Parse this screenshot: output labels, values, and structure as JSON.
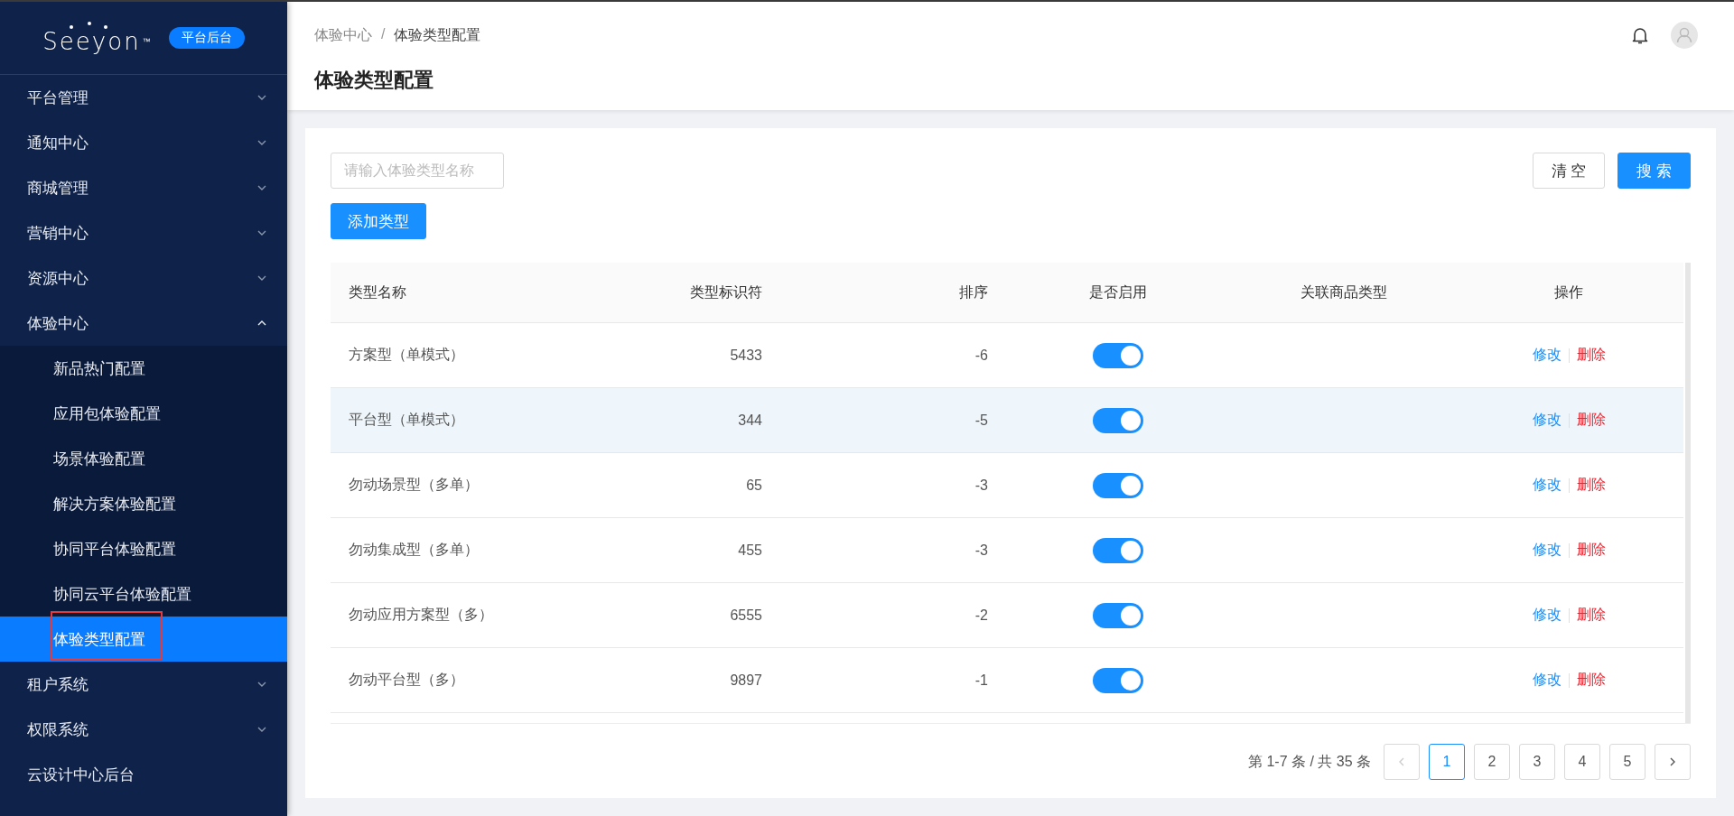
{
  "sidebar": {
    "logo": {
      "wordmark": "Seeyon",
      "trademark": "™"
    },
    "badge": "平台后台",
    "items": [
      {
        "label": "平台管理",
        "expanded": false
      },
      {
        "label": "通知中心",
        "expanded": false
      },
      {
        "label": "商城管理",
        "expanded": false
      },
      {
        "label": "营销中心",
        "expanded": false
      },
      {
        "label": "资源中心",
        "expanded": false
      },
      {
        "label": "体验中心",
        "expanded": true,
        "children": [
          {
            "label": "新品热门配置",
            "selected": false,
            "annotated": false
          },
          {
            "label": "应用包体验配置",
            "selected": false,
            "annotated": false
          },
          {
            "label": "场景体验配置",
            "selected": false,
            "annotated": false
          },
          {
            "label": "解决方案体验配置",
            "selected": false,
            "annotated": false
          },
          {
            "label": "协同平台体验配置",
            "selected": false,
            "annotated": false
          },
          {
            "label": "协同云平台体验配置",
            "selected": false,
            "annotated": false
          },
          {
            "label": "体验类型配置",
            "selected": true,
            "annotated": true
          }
        ]
      },
      {
        "label": "租户系统",
        "expanded": false
      },
      {
        "label": "权限系统",
        "expanded": false
      },
      {
        "label": "云设计中心后台"
      }
    ]
  },
  "header": {
    "breadcrumb": [
      "体验中心",
      "体验类型配置"
    ],
    "separator": "/",
    "title": "体验类型配置"
  },
  "toolbar": {
    "search": {
      "placeholder": "请输入体验类型名称"
    },
    "clear_button": "清 空",
    "search_button": "搜 索",
    "add_button": "添加类型"
  },
  "table": {
    "columns": [
      "类型名称",
      "类型标识符",
      "排序",
      "是否启用",
      "关联商品类型",
      "操作"
    ],
    "rows": [
      {
        "name": "方案型（单模式）",
        "code": "5433",
        "sort": "-6",
        "enabled": true,
        "hovered": false,
        "actions": [
          {
            "label": "修改",
            "kind": "edit"
          },
          {
            "label": "删除",
            "kind": "delete"
          }
        ]
      },
      {
        "name": "平台型（单模式）",
        "code": "344",
        "sort": "-5",
        "enabled": true,
        "hovered": true,
        "actions": [
          {
            "label": "修改",
            "kind": "edit"
          },
          {
            "label": "删除",
            "kind": "delete"
          }
        ]
      },
      {
        "name": "勿动场景型（多单）",
        "code": "65",
        "sort": "-3",
        "enabled": true,
        "hovered": false,
        "actions": [
          {
            "label": "修改",
            "kind": "edit"
          },
          {
            "label": "删除",
            "kind": "delete"
          }
        ]
      },
      {
        "name": "勿动集成型（多单）",
        "code": "455",
        "sort": "-3",
        "enabled": true,
        "hovered": false,
        "actions": [
          {
            "label": "修改",
            "kind": "edit"
          },
          {
            "label": "删除",
            "kind": "delete"
          }
        ]
      },
      {
        "name": "勿动应用方案型（多）",
        "code": "6555",
        "sort": "-2",
        "enabled": true,
        "hovered": false,
        "actions": [
          {
            "label": "修改",
            "kind": "edit"
          },
          {
            "label": "删除",
            "kind": "delete"
          }
        ]
      },
      {
        "name": "勿动平台型（多）",
        "code": "9897",
        "sort": "-1",
        "enabled": true,
        "hovered": false,
        "actions": [
          {
            "label": "修改",
            "kind": "edit"
          },
          {
            "label": "删除",
            "kind": "delete"
          }
        ]
      }
    ]
  },
  "pagination": {
    "summary": "第 1-7 条 / 共 35 条",
    "prev_disabled": true,
    "next_disabled": false,
    "pages": [
      {
        "label": "1",
        "selected": true
      },
      {
        "label": "2",
        "selected": false
      },
      {
        "label": "3",
        "selected": false
      },
      {
        "label": "4",
        "selected": false
      },
      {
        "label": "5",
        "selected": false
      }
    ]
  }
}
